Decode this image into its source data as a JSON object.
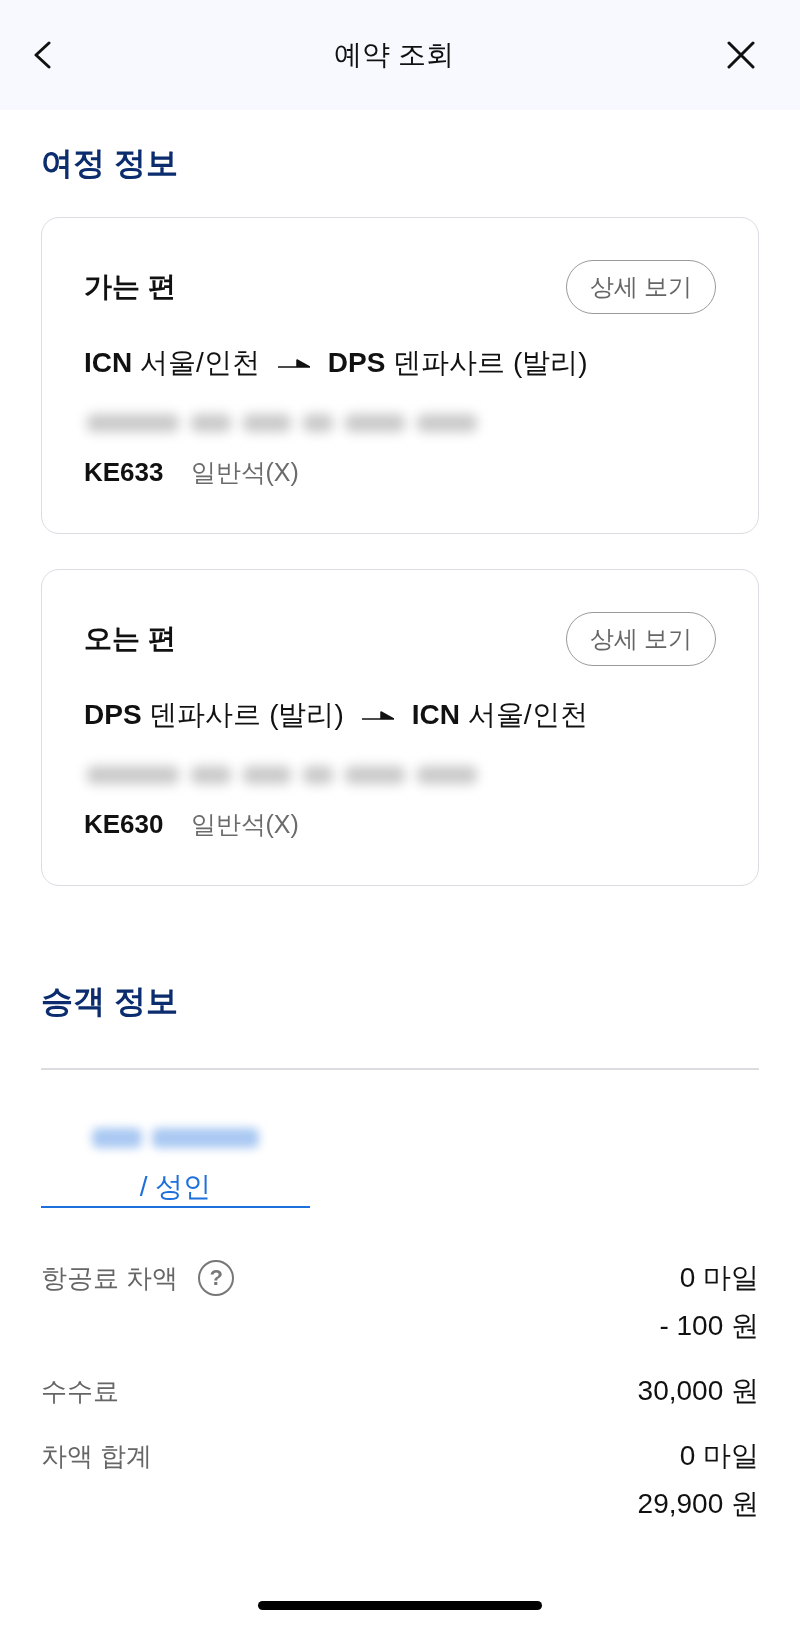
{
  "header": {
    "title": "예약 조회"
  },
  "itinerary": {
    "heading": "여정 정보",
    "flights": [
      {
        "direction": "가는 편",
        "detail_button": "상세 보기",
        "origin": {
          "code": "ICN",
          "city": "서울/인천"
        },
        "destination": {
          "code": "DPS",
          "city": "덴파사르 (발리)"
        },
        "flight_number": "KE633",
        "cabin": "일반석(X)"
      },
      {
        "direction": "오는 편",
        "detail_button": "상세 보기",
        "origin": {
          "code": "DPS",
          "city": "덴파사르 (발리)"
        },
        "destination": {
          "code": "ICN",
          "city": "서울/인천"
        },
        "flight_number": "KE630",
        "cabin": "일반석(X)"
      }
    ]
  },
  "passengers": {
    "heading": "승객 정보",
    "tabs": [
      {
        "label": "/ 성인",
        "selected": true
      }
    ]
  },
  "fares": [
    {
      "label": "항공료 차액",
      "help_icon": "?",
      "values": [
        "0 마일",
        "- 100 원"
      ]
    },
    {
      "label": "수수료",
      "values": [
        "30,000 원"
      ]
    },
    {
      "label": "차액 합계",
      "values": [
        "0 마일",
        "29,900 원"
      ]
    }
  ]
}
